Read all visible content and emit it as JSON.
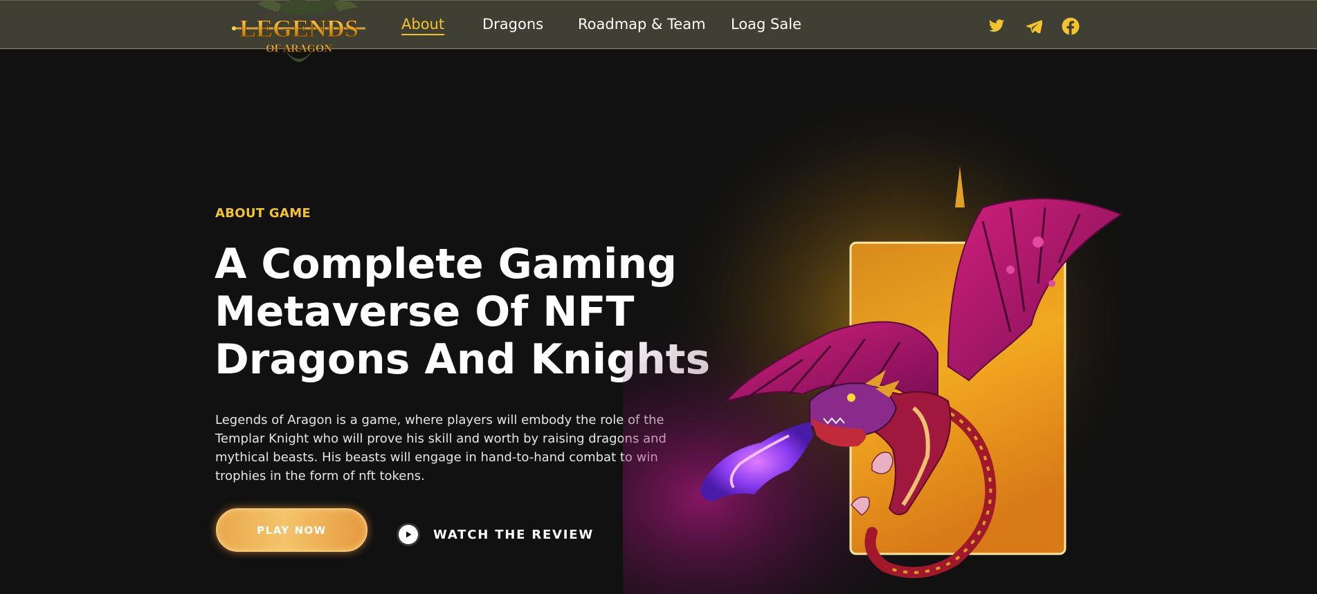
{
  "brand": {
    "logo_line1": "LEGENDS",
    "logo_line2": "OF ARAGON"
  },
  "nav": {
    "items": [
      {
        "label": "About",
        "active": true
      },
      {
        "label": "Dragons",
        "active": false
      },
      {
        "label": "Roadmap & Team",
        "active": false
      },
      {
        "label": "Loag Sale",
        "active": false
      }
    ]
  },
  "social": {
    "icons": [
      "twitter-icon",
      "telegram-icon",
      "facebook-icon"
    ]
  },
  "hero": {
    "eyebrow": "ABOUT GAME",
    "headline_lines": [
      "A Complete Gaming",
      "Metaverse Of NFT",
      "Dragons And Knights"
    ],
    "description_lines": [
      "Legends of Aragon is a game, where players will embody the role of the",
      "Templar Knight who will prove his skill and worth by raising dragons and",
      "mythical beasts. His beasts will engage in hand-to-hand combat to win",
      "trophies in the form of nft tokens."
    ],
    "play_button": "PLAY NOW",
    "watch_label": "WATCH THE REVIEW"
  },
  "colors": {
    "accent": "#f4c430",
    "header_bg": "#403f33",
    "page_bg": "#111111",
    "card_orange": "#e8941c",
    "dragon_magenta": "#b0196a",
    "fire_purple": "#8a3cf0"
  }
}
